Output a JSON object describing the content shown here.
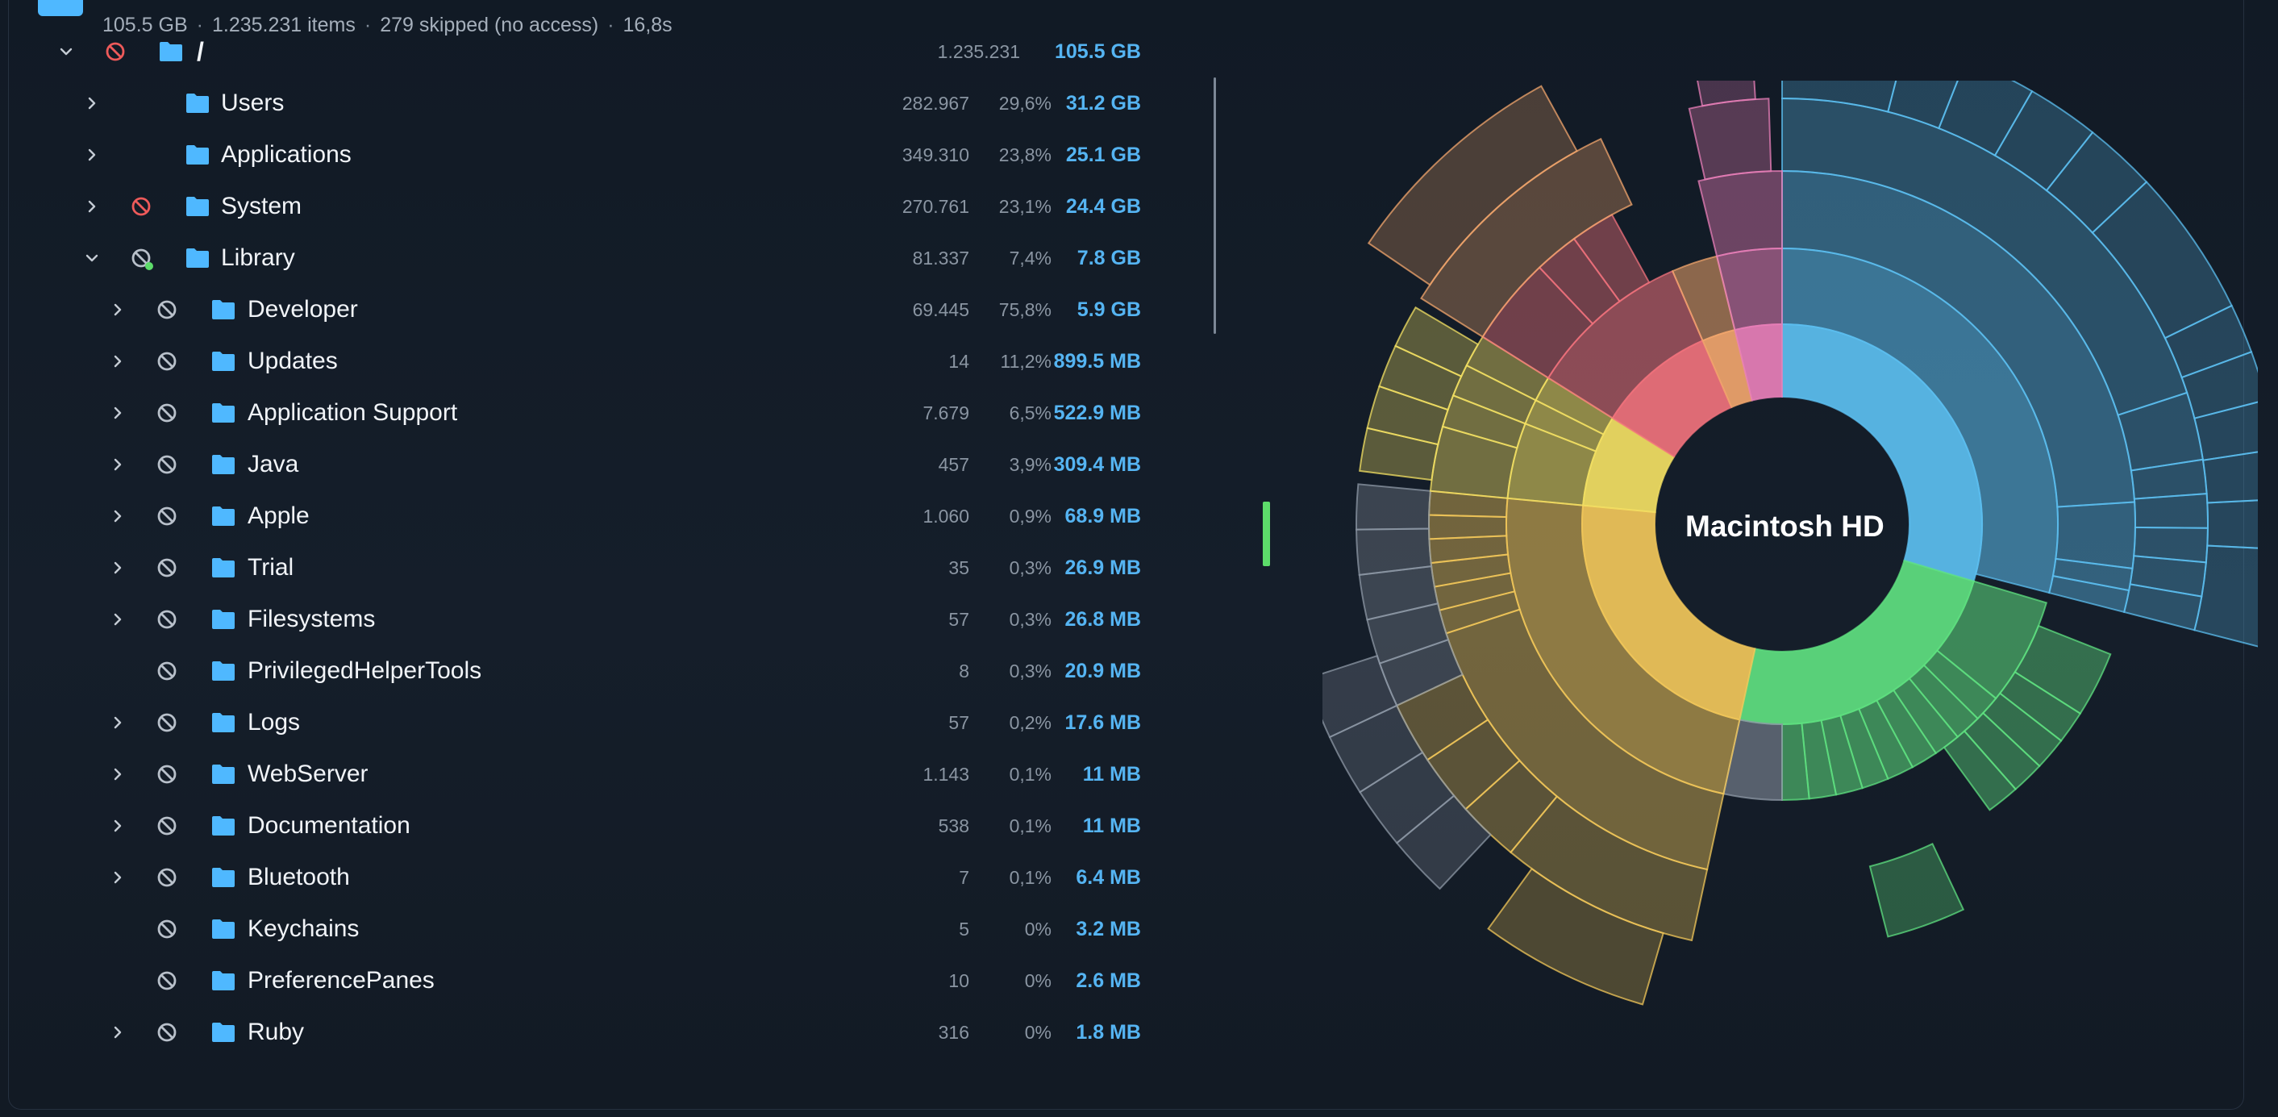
{
  "summary": {
    "total_size": "105.5 GB",
    "items": "1.235.231 items",
    "skipped": "279 skipped (no access)",
    "time": "16,8s",
    "separator": "·"
  },
  "tree": [
    {
      "name": "/",
      "count": "1.235.231",
      "pct": "",
      "size": "105.5 GB",
      "level": 0,
      "expanded": true,
      "chevron": true,
      "noaccess": "red"
    },
    {
      "name": "Users",
      "count": "282.967",
      "pct": "29,6%",
      "size": "31.2 GB",
      "level": 1,
      "expanded": false,
      "chevron": true,
      "noaccess": "none"
    },
    {
      "name": "Applications",
      "count": "349.310",
      "pct": "23,8%",
      "size": "25.1 GB",
      "level": 1,
      "expanded": false,
      "chevron": true,
      "noaccess": "none"
    },
    {
      "name": "System",
      "count": "270.761",
      "pct": "23,1%",
      "size": "24.4 GB",
      "level": 1,
      "expanded": false,
      "chevron": true,
      "noaccess": "red"
    },
    {
      "name": "Library",
      "count": "81.337",
      "pct": "7,4%",
      "size": "7.8 GB",
      "level": 1,
      "expanded": true,
      "chevron": true,
      "noaccess": "gray-dot"
    },
    {
      "name": "Developer",
      "count": "69.445",
      "pct": "75,8%",
      "size": "5.9 GB",
      "level": 2,
      "expanded": false,
      "chevron": true,
      "noaccess": "gray"
    },
    {
      "name": "Updates",
      "count": "14",
      "pct": "11,2%",
      "size": "899.5 MB",
      "level": 2,
      "expanded": false,
      "chevron": true,
      "noaccess": "gray"
    },
    {
      "name": "Application Support",
      "count": "7.679",
      "pct": "6,5%",
      "size": "522.9 MB",
      "level": 2,
      "expanded": false,
      "chevron": true,
      "noaccess": "gray"
    },
    {
      "name": "Java",
      "count": "457",
      "pct": "3,9%",
      "size": "309.4 MB",
      "level": 2,
      "expanded": false,
      "chevron": true,
      "noaccess": "gray"
    },
    {
      "name": "Apple",
      "count": "1.060",
      "pct": "0,9%",
      "size": "68.9 MB",
      "level": 2,
      "expanded": false,
      "chevron": true,
      "noaccess": "gray"
    },
    {
      "name": "Trial",
      "count": "35",
      "pct": "0,3%",
      "size": "26.9 MB",
      "level": 2,
      "expanded": false,
      "chevron": true,
      "noaccess": "gray"
    },
    {
      "name": "Filesystems",
      "count": "57",
      "pct": "0,3%",
      "size": "26.8 MB",
      "level": 2,
      "expanded": false,
      "chevron": true,
      "noaccess": "gray"
    },
    {
      "name": "PrivilegedHelperTools",
      "count": "8",
      "pct": "0,3%",
      "size": "20.9 MB",
      "level": 2,
      "expanded": false,
      "chevron": false,
      "noaccess": "gray"
    },
    {
      "name": "Logs",
      "count": "57",
      "pct": "0,2%",
      "size": "17.6 MB",
      "level": 2,
      "expanded": false,
      "chevron": true,
      "noaccess": "gray"
    },
    {
      "name": "WebServer",
      "count": "1.143",
      "pct": "0,1%",
      "size": "11 MB",
      "level": 2,
      "expanded": false,
      "chevron": true,
      "noaccess": "gray"
    },
    {
      "name": "Documentation",
      "count": "538",
      "pct": "0,1%",
      "size": "11 MB",
      "level": 2,
      "expanded": false,
      "chevron": true,
      "noaccess": "gray"
    },
    {
      "name": "Bluetooth",
      "count": "7",
      "pct": "0,1%",
      "size": "6.4 MB",
      "level": 2,
      "expanded": false,
      "chevron": true,
      "noaccess": "gray"
    },
    {
      "name": "Keychains",
      "count": "5",
      "pct": "0%",
      "size": "3.2 MB",
      "level": 2,
      "expanded": false,
      "chevron": false,
      "noaccess": "gray"
    },
    {
      "name": "PreferencePanes",
      "count": "10",
      "pct": "0%",
      "size": "2.6 MB",
      "level": 2,
      "expanded": false,
      "chevron": false,
      "noaccess": "gray"
    },
    {
      "name": "Ruby",
      "count": "316",
      "pct": "0%",
      "size": "1.8 MB",
      "level": 2,
      "expanded": false,
      "chevron": true,
      "noaccess": "gray"
    }
  ],
  "sunburst": {
    "center_label": "Macintosh HD",
    "rings": [
      [
        {
          "name": "Users",
          "start": 0.0,
          "end": 0.296,
          "color": "#5cbff0"
        },
        {
          "name": "Applications",
          "start": 0.296,
          "end": 0.534,
          "color": "#5fe080"
        },
        {
          "name": "System",
          "start": 0.534,
          "end": 0.765,
          "color": "#f2c75a"
        },
        {
          "name": "Library",
          "start": 0.765,
          "end": 0.839,
          "color": "#f3e063"
        },
        {
          "name": "other-red",
          "start": 0.839,
          "end": 0.935,
          "color": "#f0727c"
        },
        {
          "name": "other-orange",
          "start": 0.935,
          "end": 0.962,
          "color": "#f1a56c"
        },
        {
          "name": "other-pink",
          "start": 0.962,
          "end": 1.0,
          "color": "#e87fb8"
        }
      ]
    ],
    "colors": {
      "users": "#5cbff0",
      "applications": "#5fe080",
      "system": "#f2c75a",
      "library": "#f3e063",
      "red": "#f0727c",
      "orange": "#f1a56c",
      "pink": "#e87fb8",
      "gray": "#8e98a6"
    }
  },
  "icons": {
    "chevron_right": "chevron-right-icon",
    "chevron_down": "chevron-down-icon",
    "no_access": "no-access-icon",
    "folder": "folder-icon"
  },
  "colors": {
    "accent_size": "#55b4f2",
    "folder": "#4fb8ff",
    "no_access_red": "#ee5a5a",
    "no_access_gray": "#b8c0ca",
    "status_green": "#5ddc6a"
  }
}
